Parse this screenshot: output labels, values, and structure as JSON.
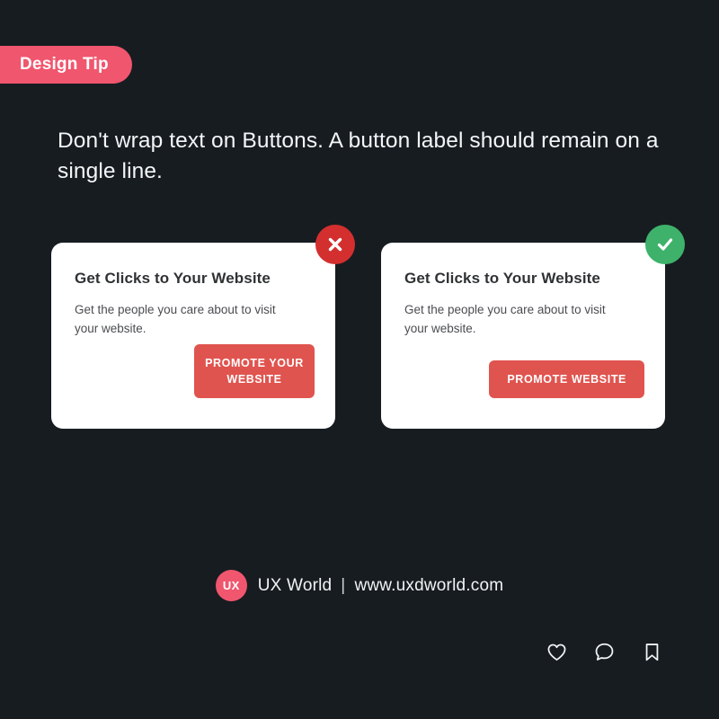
{
  "badge": {
    "label": "Design Tip",
    "color": "#f0566e"
  },
  "headline": {
    "text": "Don't wrap text on Buttons. A button label should remain on a single line."
  },
  "background_color": "#171c21",
  "cards": [
    {
      "variant": "bad",
      "status_icon": "close-icon",
      "status_color": "#d32f2f",
      "title": "Get Clicks to Your Website",
      "body": "Get the people you care about to visit your website.",
      "cta_label": "PROMOTE YOUR WEBSITE",
      "cta_color": "#e0544f"
    },
    {
      "variant": "good",
      "status_icon": "check-icon",
      "status_color": "#3eb26a",
      "title": "Get Clicks to Your Website",
      "body": "Get the people you care about to visit your website.",
      "cta_label": "PROMOTE WEBSITE",
      "cta_color": "#e0544f"
    }
  ],
  "footer": {
    "logo_text": "UX",
    "logo_color": "#f0566e",
    "brand_name": "UX World",
    "separator": "|",
    "website": "www.uxdworld.com"
  },
  "actions": [
    {
      "icon": "heart-icon",
      "name": "like"
    },
    {
      "icon": "comment-icon",
      "name": "comment"
    },
    {
      "icon": "bookmark-icon",
      "name": "save"
    }
  ]
}
